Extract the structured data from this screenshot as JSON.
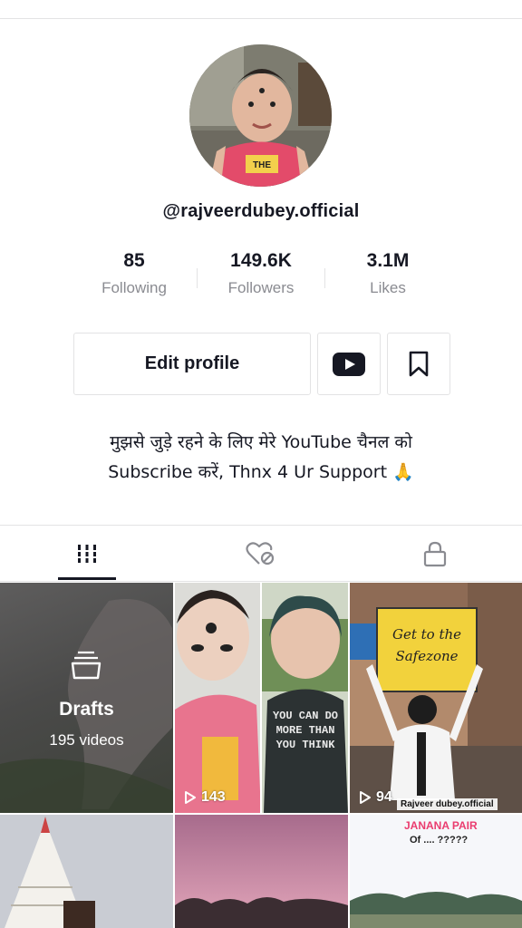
{
  "profile": {
    "username": "@rajveerdubey.official",
    "avatar_shirt_text": "THE"
  },
  "stats": [
    {
      "value": "85",
      "label": "Following"
    },
    {
      "value": "149.6K",
      "label": "Followers"
    },
    {
      "value": "3.1M",
      "label": "Likes"
    }
  ],
  "actions": {
    "edit_profile_label": "Edit profile",
    "youtube_icon": "youtube-icon",
    "bookmark_icon": "bookmark-icon"
  },
  "bio": {
    "line1": "मुझसे जुड़े रहने के लिए मेरे YouTube चैनल को",
    "line2": "Subscribe करें, Thnx 4 Ur Support 🙏"
  },
  "tabs": [
    {
      "icon": "grid-icon",
      "active": true
    },
    {
      "icon": "liked-heart-icon",
      "active": false
    },
    {
      "icon": "lock-icon",
      "active": false
    }
  ],
  "grid": {
    "drafts": {
      "title": "Drafts",
      "count": "195 videos",
      "icon": "drafts-tray-icon"
    },
    "videos": [
      {
        "views": "143",
        "text": [
          "YOU CAN DO",
          "MORE THAN",
          "YOU THINK"
        ]
      },
      {
        "views": "94",
        "sign": [
          "Get to the",
          "Safezone"
        ],
        "tag": "Rajveer dubey.official"
      },
      {
        "overlay": "Of .... ?????"
      }
    ]
  },
  "colors": {
    "text_primary": "#161823",
    "text_secondary": "#8a8b91",
    "divider": "#e3e3e4",
    "youtube_red": "#161823"
  }
}
